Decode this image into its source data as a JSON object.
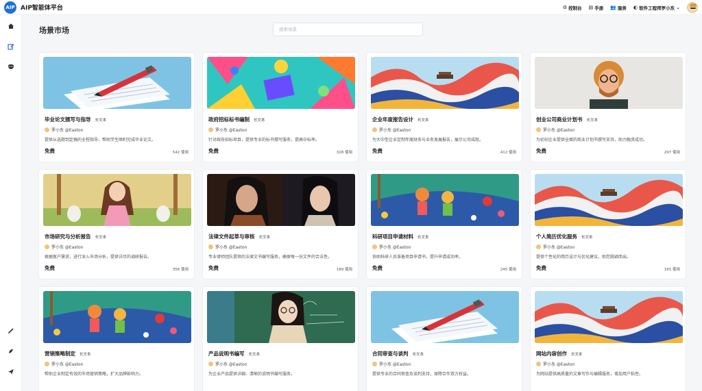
{
  "header": {
    "logo_text": "AIP",
    "app_title": "AIP智能体平台",
    "nav": [
      {
        "icon": "console-icon",
        "glyph": "⚙",
        "label": "控制台"
      },
      {
        "icon": "manual-icon",
        "glyph": "▤",
        "label": "手册"
      },
      {
        "icon": "service-icon",
        "glyph": "👥",
        "label": "服务"
      },
      {
        "icon": "shield-icon",
        "glyph": "◐",
        "label": "软件工程师罗小东"
      }
    ]
  },
  "sidebar": {
    "icons": [
      "home-icon",
      "edit-icon",
      "mask-icon",
      "pen-icon",
      "feather-icon",
      "send-icon"
    ]
  },
  "main": {
    "title": "场景市场",
    "search_placeholder": "搜索场景"
  },
  "cards": [
    {
      "title": "毕业论文撰写与指导",
      "tag": "长文本",
      "author": "罗小东 @Easton",
      "desc": "提供从选题到定稿的全程指导，帮助学生顺利完成毕业论文。",
      "price": "免费",
      "uses": "542 使用",
      "image": "pen-paper"
    },
    {
      "title": "政府招标标书编制",
      "tag": "长文本",
      "author": "罗小东 @Easton",
      "desc": "针对政府招标项目，提供专业的标书撰写服务，提高中标率。",
      "price": "免费",
      "uses": "328 使用",
      "image": "colorful-abstract"
    },
    {
      "title": "企业年度报告设计",
      "tag": "长文本",
      "author": "罗小东 @Easton",
      "desc": "为大中型企业定制年度财务与业务发展报告，展示公司成就。",
      "price": "免费",
      "uses": "412 使用",
      "image": "mountain-waves"
    },
    {
      "title": "创业公司商业计划书",
      "tag": "长文本",
      "author": "罗小东 @Easton",
      "desc": "为初创企业提供全面的商业计划书撰写支持，助力融资成功。",
      "price": "免费",
      "uses": "297 使用",
      "image": "man-portrait"
    },
    {
      "title": "市场研究与分析报告",
      "tag": "长文本",
      "author": "罗小东 @Easton",
      "desc": "根据客户需求，进行深入市场分析，提供详尽的调研报告。",
      "price": "免费",
      "uses": "356 使用",
      "image": "princess-forest"
    },
    {
      "title": "法律文件起草与审核",
      "tag": "长文本",
      "author": "罗小东 @Easton",
      "desc": "专业律师团队提供的法律文书编写服务，确保每一份文件的合法性。",
      "price": "免费",
      "uses": "189 使用",
      "image": "women-portrait"
    },
    {
      "title": "科研项目申请材料",
      "tag": "长文本",
      "author": "罗小东 @Easton",
      "desc": "协助科研人员准备项目申请书，提升申请成功率。",
      "price": "免费",
      "uses": "245 使用",
      "image": "kids-garden"
    },
    {
      "title": "个人简历优化服务",
      "tag": "长文本",
      "author": "罗小东 @Easton",
      "desc": "提供个性化的简历设计与优化建议，助您脱颖而出。",
      "price": "免费",
      "uses": "165 使用",
      "image": "mountain-waves"
    },
    {
      "title": "营销策略制定",
      "tag": "长文本",
      "author": "罗小东 @Easton",
      "desc": "帮助企业制定有效的市场营销策略，扩大品牌影响力。",
      "price": "",
      "uses": "",
      "image": "kids-garden"
    },
    {
      "title": "产品说明书编写",
      "tag": "长文本",
      "author": "罗小东 @Easton",
      "desc": "为企业产品提供详细、清晰的说明书编写服务。",
      "price": "",
      "uses": "",
      "image": "teacher-chalkboard"
    },
    {
      "title": "合同审查与谈判",
      "tag": "长文本",
      "author": "罗小东 @Easton",
      "desc": "提供专业的合同审查及谈判支持，保障合作双方权益。",
      "price": "",
      "uses": "",
      "image": "pen-paper"
    },
    {
      "title": "网站内容创作",
      "tag": "长文本",
      "author": "罗小东 @Easton",
      "desc": "为网站提供高质量的文章写作与编辑服务，增加用户粘性。",
      "price": "",
      "uses": "",
      "image": "mountain-waves"
    }
  ]
}
